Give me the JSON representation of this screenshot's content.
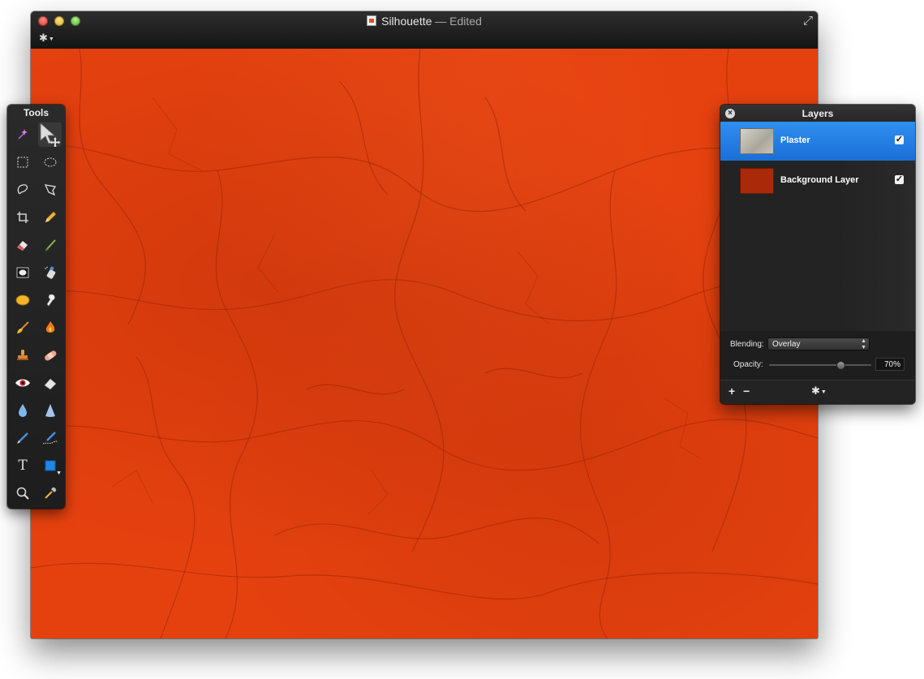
{
  "window": {
    "title": "Silhouette",
    "title_separator": " — ",
    "title_status": "Edited",
    "icons": [
      "document-icon",
      "fullscreen-icon",
      "gear-icon"
    ]
  },
  "canvas": {
    "color": "#e5410f",
    "texture": "cracked plaster"
  },
  "tools": {
    "title": "Tools",
    "items": [
      "magic-wand-icon",
      "move-arrow-icon",
      "rect-select-icon",
      "ellipse-select-icon",
      "lasso-icon",
      "polygon-lasso-icon",
      "crop-icon",
      "pencil-icon",
      "eraser-icon",
      "brush-icon",
      "vignette-icon",
      "spray-icon",
      "sponge-icon",
      "smudge-icon",
      "sweep-brush-icon",
      "burn-icon",
      "stamp-icon",
      "bandage-icon",
      "red-eye-icon",
      "erase-block-icon",
      "blur-drop-icon",
      "sharpen-cone-icon",
      "pen-icon",
      "freeform-pen-icon",
      "text-icon",
      "shape-icon",
      "zoom-icon",
      "eyedropper-icon"
    ],
    "text_tool_glyph": "T"
  },
  "layers": {
    "title": "Layers",
    "items": [
      {
        "name": "Plaster",
        "selected": true,
        "visible": true
      },
      {
        "name": "Background Layer",
        "selected": false,
        "visible": true
      }
    ],
    "blending_label": "Blending:",
    "blending_value": "Overlay",
    "opacity_label": "Opacity:",
    "opacity_value": "70%",
    "opacity_fraction": 0.7,
    "add_glyph": "+",
    "remove_glyph": "−",
    "check_glyph": "✓",
    "close_glyph": "×",
    "accent": "#1f7ae0"
  }
}
